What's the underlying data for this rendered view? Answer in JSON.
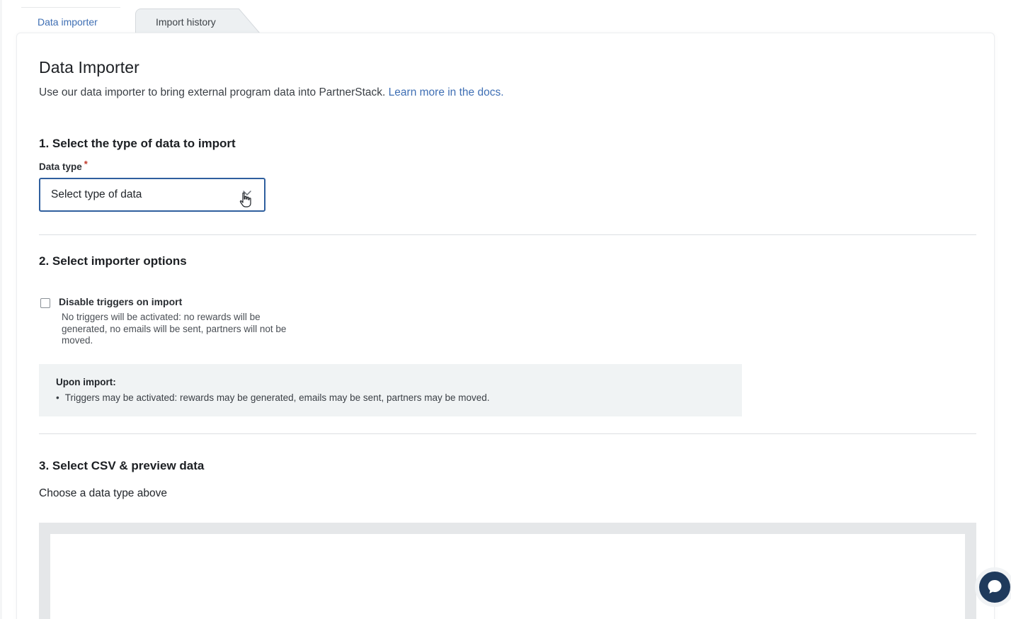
{
  "tabs": [
    {
      "label": "Data importer",
      "active": true
    },
    {
      "label": "Import history",
      "active": false
    }
  ],
  "header": {
    "title": "Data Importer",
    "subtitle": "Use our data importer to bring external program data into PartnerStack.",
    "docs_link": "Learn more in the docs."
  },
  "section1": {
    "heading": "1. Select the type of data to import",
    "field_label": "Data type",
    "required_marker": "*",
    "select_value": "Select type of data"
  },
  "section2": {
    "heading": "2. Select importer options",
    "checkbox_label": "Disable triggers on import",
    "checkbox_checked": false,
    "checkbox_description": "No triggers will be activated: no rewards will be generated, no emails will be sent, partners will not be moved.",
    "info_title": "Upon import:",
    "info_bullet": "Triggers may be activated: rewards may be generated, emails may be sent, partners may be moved."
  },
  "section3": {
    "heading": "3. Select CSV & preview data",
    "hint": "Choose a data type above"
  },
  "icons": {
    "select": "chevron-down-icon",
    "cursor": "hand-pointer-icon",
    "chat": "chat-bubble-icon"
  },
  "colors": {
    "accent": "#3f6fb4",
    "focus_border": "#2f5f9e",
    "required": "#c0392b",
    "info_bg": "#f0f3f4",
    "chat_button": "#1f3a5c"
  }
}
